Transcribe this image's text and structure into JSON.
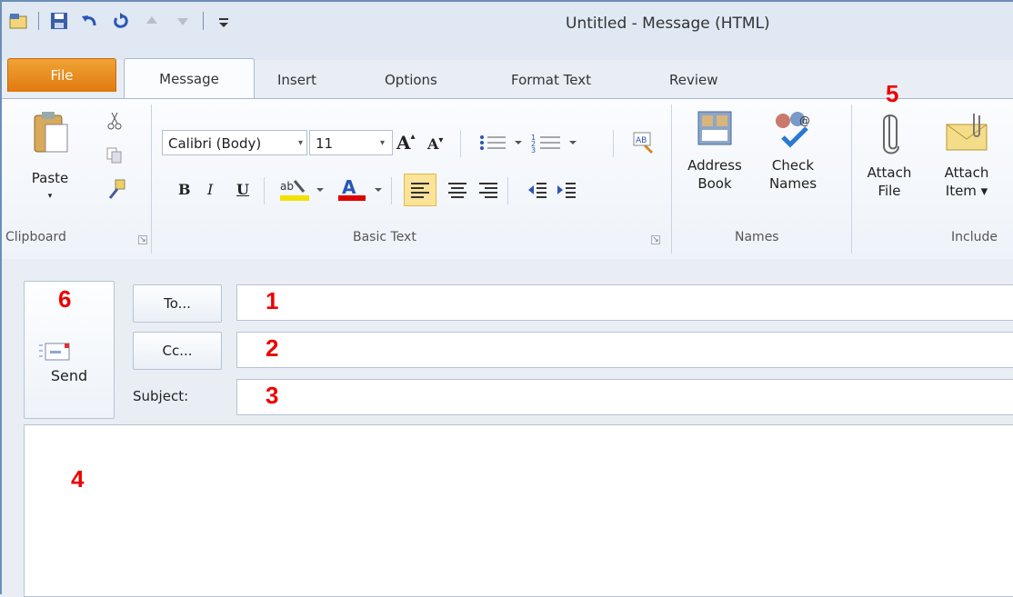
{
  "window": {
    "title": "Untitled - Message (HTML)"
  },
  "qat": {
    "icons": [
      "app-icon",
      "save-icon",
      "undo-icon",
      "redo-icon",
      "up-arrow-icon",
      "down-arrow-icon",
      "customize-qat-icon"
    ]
  },
  "tabs": [
    {
      "label": "File"
    },
    {
      "label": "Message"
    },
    {
      "label": "Insert"
    },
    {
      "label": "Options"
    },
    {
      "label": "Format Text"
    },
    {
      "label": "Review"
    }
  ],
  "ribbon": {
    "clipboard": {
      "paste_label": "Paste",
      "group_label": "Clipboard"
    },
    "basic_text": {
      "font_name": "Calibri (Body)",
      "font_size": "11",
      "group_label": "Basic Text"
    },
    "names": {
      "address_book_line1": "Address",
      "address_book_line2": "Book",
      "check_names_line1": "Check",
      "check_names_line2": "Names",
      "group_label": "Names"
    },
    "include": {
      "attach_file_line1": "Attach",
      "attach_file_line2": "File",
      "attach_item_line1": "Attach",
      "attach_item_line2": "Item ▾",
      "group_label": "Include"
    }
  },
  "compose": {
    "send_label": "Send",
    "to_label": "To...",
    "cc_label": "Cc...",
    "subject_label": "Subject:"
  },
  "annotations": [
    "1",
    "2",
    "3",
    "4",
    "5",
    "6"
  ],
  "colors": {
    "file_tab": "#e07a11",
    "annotation": "#e00000",
    "highlight": "#f5d33a",
    "font_color": "#e00000"
  }
}
